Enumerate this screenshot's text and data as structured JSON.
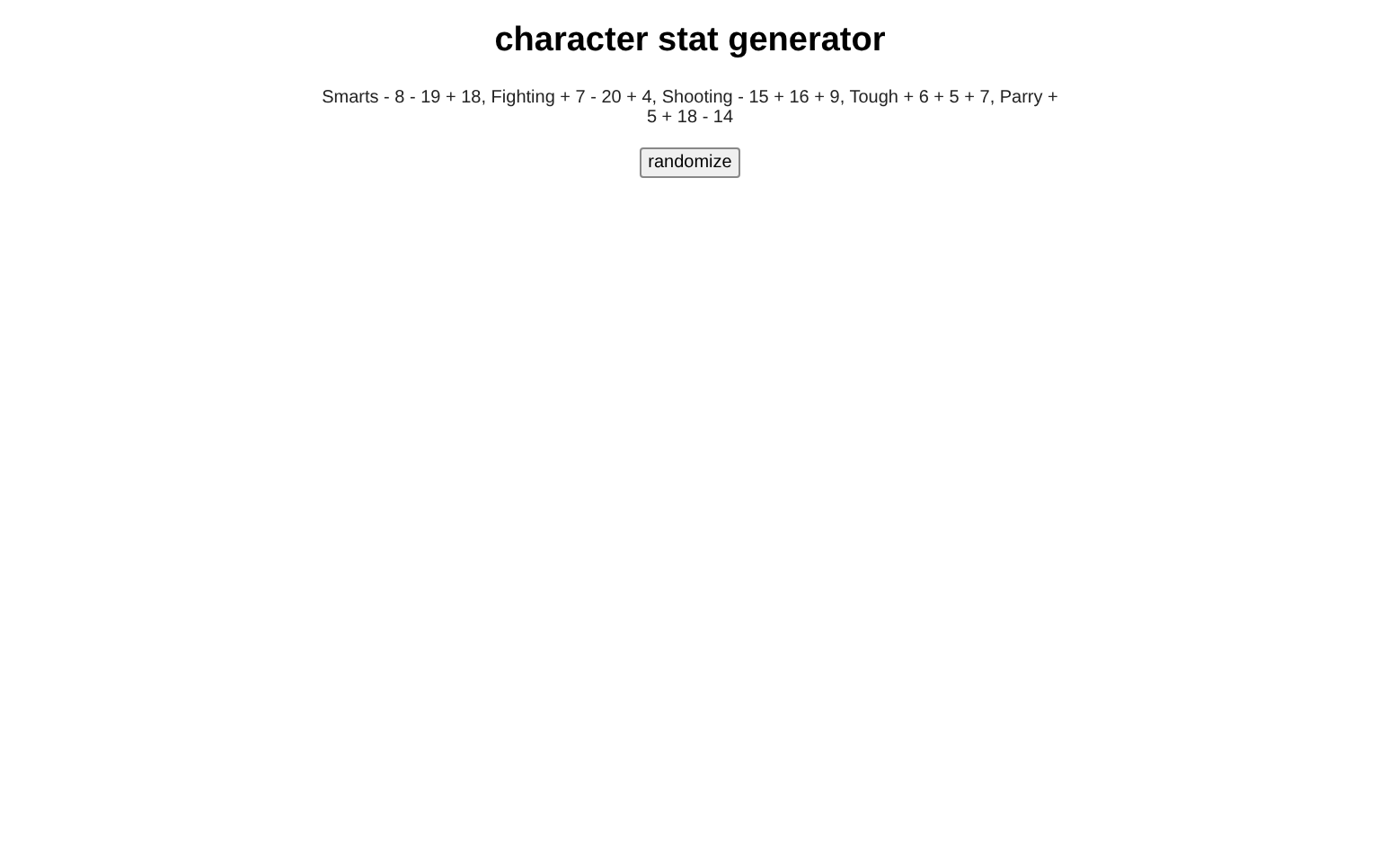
{
  "title": "character stat generator",
  "stats": "Smarts - 8 - 19 + 18, Fighting + 7 - 20 + 4, Shooting - 15 + 16 + 9, Tough + 6 + 5 + 7, Parry + 5 + 18 - 14",
  "button": "randomize"
}
